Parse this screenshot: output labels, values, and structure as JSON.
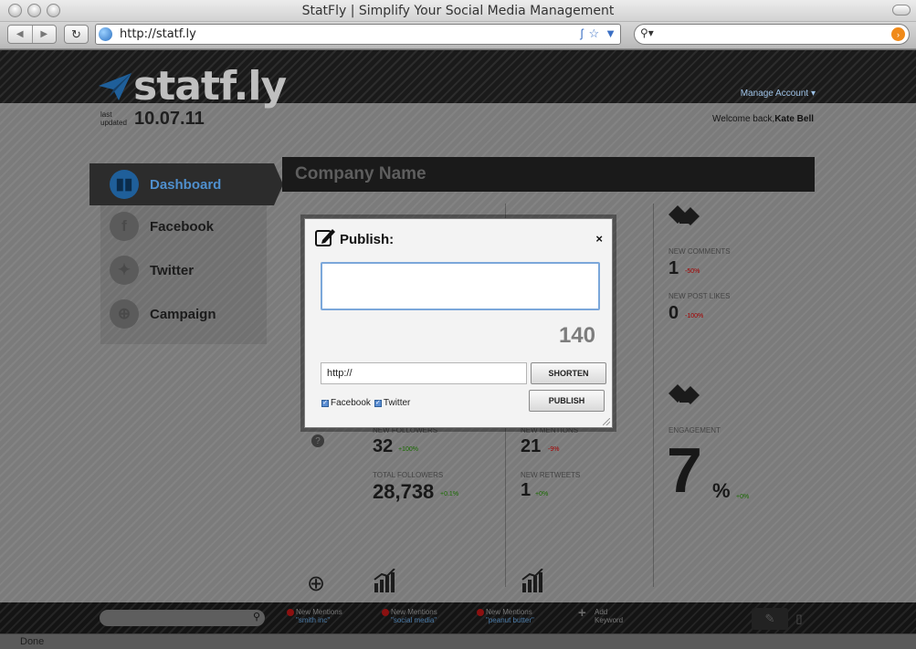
{
  "window": {
    "title": "StatFly | Simplify Your Social Media Management"
  },
  "browser": {
    "url": "http://statf.ly",
    "back_icon": "back-arrow-icon",
    "forward_icon": "forward-arrow-icon",
    "reload_icon": "reload-icon",
    "search_placeholder": ""
  },
  "header": {
    "logo_text": "statf.ly",
    "manage_account": "Manage Account",
    "last_updated_label": "last updated",
    "last_updated_date": "10.07.11",
    "welcome_prefix": "Welcome back,",
    "welcome_user": "Kate Bell"
  },
  "sidebar": {
    "items": [
      {
        "label": "Dashboard",
        "icon": "bar-chart-icon",
        "active": true
      },
      {
        "label": "Facebook",
        "icon": "facebook-icon",
        "active": false
      },
      {
        "label": "Twitter",
        "icon": "twitter-icon",
        "active": false
      },
      {
        "label": "Campaign",
        "icon": "crosshair-icon",
        "active": false
      }
    ]
  },
  "main": {
    "company_name": "Company Name",
    "stats_right_top": {
      "new_comments_label": "NEW COMMENTS",
      "new_comments_value": "1",
      "new_comments_change": "-50%",
      "new_post_likes_label": "NEW POST LIKES",
      "new_post_likes_value": "0",
      "new_post_likes_change": "-100%"
    },
    "stats_followers": {
      "new_followers_label": "NEW FOLLOWERS",
      "new_followers_value": "32",
      "new_followers_change": "+100%",
      "total_followers_label": "TOTAL FOLLOWERS",
      "total_followers_value": "28,738",
      "total_followers_change": "+0.1%"
    },
    "stats_mentions": {
      "new_mentions_label": "NEW MENTIONS",
      "new_mentions_value": "21",
      "new_mentions_change": "-9%",
      "new_retweets_label": "NEW RETWEETS",
      "new_retweets_value": "1",
      "new_retweets_change": "+0%"
    },
    "engagement": {
      "label": "ENGAGEMENT",
      "value": "7",
      "unit": "%",
      "change": "+0%"
    }
  },
  "bottombar": {
    "mentions": [
      {
        "title": "New Mentions",
        "keyword": "\"smith inc\""
      },
      {
        "title": "New Mentions",
        "keyword": "\"social media\""
      },
      {
        "title": "New Mentions",
        "keyword": "\"peanut butter\""
      }
    ],
    "add_keyword_line1": "Add",
    "add_keyword_line2": "Keyword"
  },
  "statusbar": {
    "text": "Done"
  },
  "modal": {
    "title": "Publish:",
    "close_label": "×",
    "message_value": "",
    "char_count": "140",
    "url_value": "http://",
    "shorten_label": "SHORTEN",
    "publish_label": "PUBLISH",
    "facebook_label": "Facebook",
    "twitter_label": "Twitter",
    "facebook_checked": true,
    "twitter_checked": true
  },
  "colors": {
    "accent_blue": "#4f8fcd",
    "focus_blue": "#7ba7da",
    "negative_red": "#a40000",
    "positive_green": "#196b00"
  }
}
